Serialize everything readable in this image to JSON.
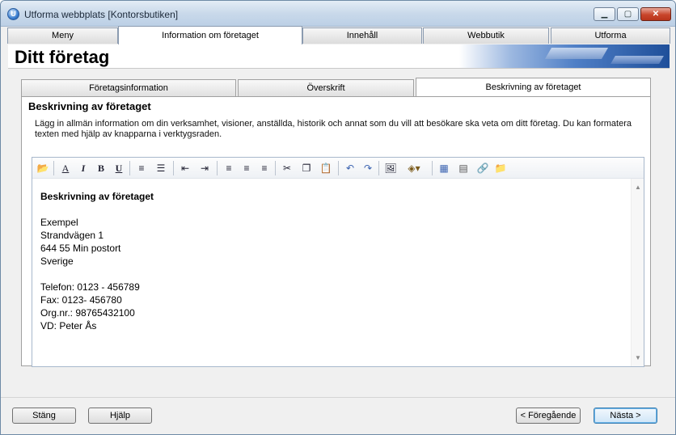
{
  "window": {
    "title": "Utforma webbplats [Kontorsbutiken]",
    "controls": {
      "minimize": "▁",
      "maximize": "▢",
      "close": "✕"
    }
  },
  "main_tabs": [
    {
      "label": "Meny"
    },
    {
      "label": "Information om företaget"
    },
    {
      "label": "Innehåll"
    },
    {
      "label": "Webbutik"
    },
    {
      "label": "Utforma"
    }
  ],
  "header": {
    "title": "Ditt företag"
  },
  "sub_tabs": [
    {
      "label": "Företagsinformation"
    },
    {
      "label": "Överskrift"
    },
    {
      "label": "Beskrivning av företaget"
    }
  ],
  "panel": {
    "title": "Beskrivning av företaget",
    "description": "Lägg in allmän information om din verksamhet, visioner, anställda, historik och annat som du vill att besökare ska veta om ditt företag. Du kan formatera texten med hjälp av knapparna i verktygsraden."
  },
  "toolbar": {
    "icons": [
      "open-folder-icon",
      "font-color-icon",
      "italic-icon",
      "bold-icon",
      "underline-icon",
      "numbered-list-icon",
      "bullet-list-icon",
      "outdent-icon",
      "indent-icon",
      "align-left-icon",
      "align-center-icon",
      "align-right-icon",
      "cut-icon",
      "copy-icon",
      "paste-icon",
      "undo-icon",
      "redo-icon",
      "insert-image-icon",
      "fill-color-icon",
      "insert-table-icon",
      "table-properties-icon",
      "insert-link-icon",
      "open-file-icon"
    ],
    "glyphs": {
      "open": "📂",
      "fontcolor": "A",
      "italic": "I",
      "bold": "B",
      "underline": "U",
      "numlist": "≡",
      "bullist": "☰",
      "outdent": "⇤",
      "indent": "⇥",
      "left": "≡",
      "center": "≡",
      "right": "≡",
      "cut": "✂",
      "copy": "❐",
      "paste": "📋",
      "undo": "↶",
      "redo": "↷",
      "image": "🖼",
      "fill": "◈▾",
      "table": "▦",
      "tableprops": "▤",
      "link": "🔗",
      "openfile": "📁"
    }
  },
  "editor": {
    "heading": "Beskrivning av företaget",
    "address": [
      "Exempel",
      "Strandvägen 1",
      "644 55 Min postort",
      "Sverige"
    ],
    "contact": [
      "Telefon: 0123 - 456789",
      "Fax: 0123- 456780",
      "Org.nr.: 98765432100",
      "VD: Peter Ås"
    ]
  },
  "footer": {
    "close": "Stäng",
    "help": "Hjälp",
    "previous": "< Föregående",
    "next": "Nästa >"
  },
  "colors": {
    "accent": "#3c7fb1",
    "titlebar": "#c9d9ea",
    "close_button": "#c8452b"
  }
}
